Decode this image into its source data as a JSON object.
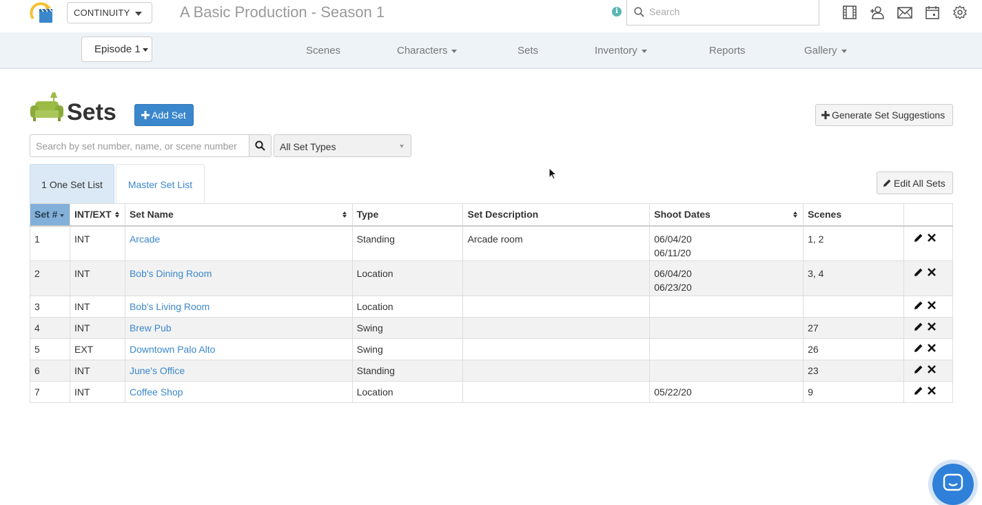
{
  "header": {
    "workspace": "CONTINUITY",
    "production_title": "A Basic Production - Season 1",
    "search_placeholder": "Search",
    "icons": [
      "info-icon",
      "film-icon",
      "add-person-icon",
      "mail-icon",
      "calendar-icon",
      "gear-icon"
    ]
  },
  "subnav": {
    "episode": "Episode 1",
    "items": [
      {
        "label": "Scenes",
        "dropdown": false
      },
      {
        "label": "Characters",
        "dropdown": true
      },
      {
        "label": "Sets",
        "dropdown": false
      },
      {
        "label": "Inventory",
        "dropdown": true
      },
      {
        "label": "Reports",
        "dropdown": false
      },
      {
        "label": "Gallery",
        "dropdown": true
      }
    ]
  },
  "page": {
    "title": "Sets",
    "add_button": "Add Set",
    "generate_button": "Generate Set Suggestions",
    "edit_all_button": "Edit All Sets",
    "search_placeholder": "Search by set number, name, or scene number",
    "type_filter": "All Set Types",
    "tabs": [
      {
        "label": "1 One Set List",
        "active": true
      },
      {
        "label": "Master Set List",
        "active": false
      }
    ]
  },
  "table": {
    "columns": [
      "Set #",
      "INT/EXT",
      "Set Name",
      "Type",
      "Set Description",
      "Shoot Dates",
      "Scenes",
      ""
    ],
    "rows": [
      {
        "num": "1",
        "intext": "INT",
        "name": "Arcade",
        "type": "Standing",
        "desc": "Arcade room",
        "dates": [
          "06/04/20",
          "06/11/20"
        ],
        "scenes": "1, 2"
      },
      {
        "num": "2",
        "intext": "INT",
        "name": "Bob's Dining Room",
        "type": "Location",
        "desc": "",
        "dates": [
          "06/04/20",
          "06/23/20"
        ],
        "scenes": "3, 4"
      },
      {
        "num": "3",
        "intext": "INT",
        "name": "Bob's Living Room",
        "type": "Location",
        "desc": "",
        "dates": [],
        "scenes": ""
      },
      {
        "num": "4",
        "intext": "INT",
        "name": "Brew Pub",
        "type": "Swing",
        "desc": "",
        "dates": [],
        "scenes": "27"
      },
      {
        "num": "5",
        "intext": "EXT",
        "name": "Downtown Palo Alto",
        "type": "Swing",
        "desc": "",
        "dates": [],
        "scenes": "26"
      },
      {
        "num": "6",
        "intext": "INT",
        "name": "June's Office",
        "type": "Standing",
        "desc": "",
        "dates": [],
        "scenes": "23"
      },
      {
        "num": "7",
        "intext": "INT",
        "name": "Coffee Shop",
        "type": "Location",
        "desc": "",
        "dates": [
          "05/22/20"
        ],
        "scenes": "9"
      }
    ]
  },
  "colors": {
    "accent": "#3b87cc",
    "sorted_header": "#82b0d8",
    "active_tab": "#dbe9f6",
    "subnav_bg": "#eef3f8",
    "logo_yellow": "#f2c230",
    "sofa_green": "#9bbb45"
  }
}
